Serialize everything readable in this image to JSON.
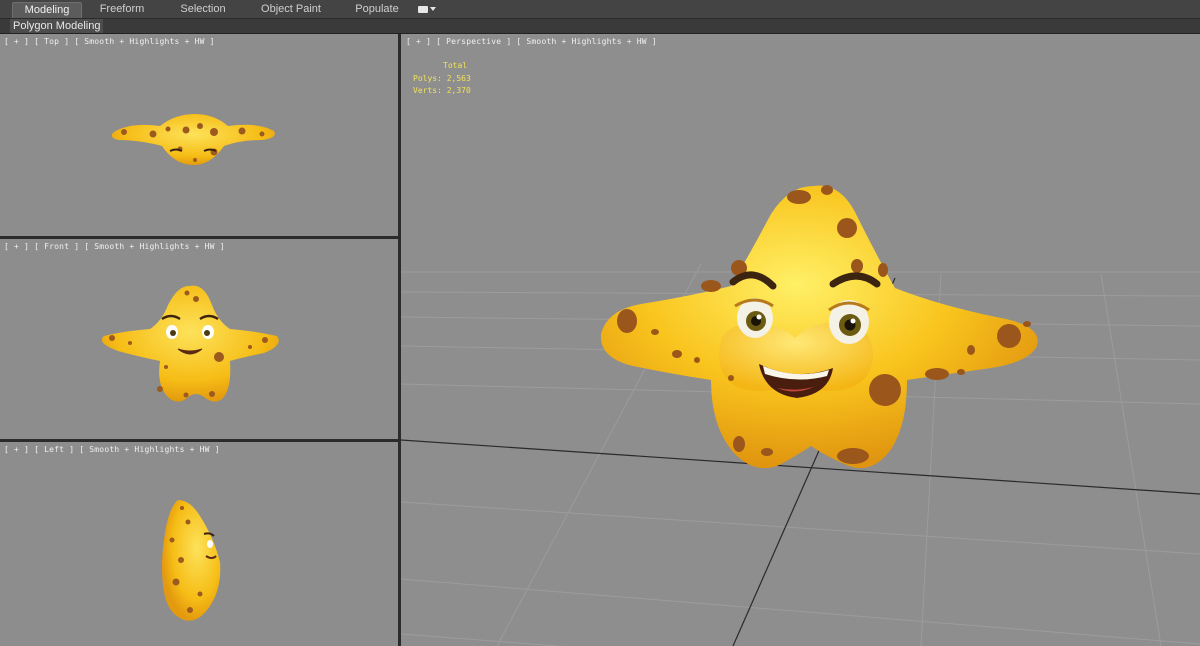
{
  "ribbon": {
    "tabs": [
      {
        "label": "Modeling",
        "active": true
      },
      {
        "label": "Freeform",
        "active": false
      },
      {
        "label": "Selection",
        "active": false
      },
      {
        "label": "Object Paint",
        "active": false
      },
      {
        "label": "Populate",
        "active": false
      }
    ],
    "panel_label": "Polygon Modeling"
  },
  "viewports": {
    "top": {
      "label": "[ + ] [ Top ] [ Smooth + Highlights + HW ]"
    },
    "front": {
      "label": "[ + ] [ Front ] [ Smooth + Highlights + HW ]"
    },
    "left": {
      "label": "[ + ] [ Left ] [ Smooth + Highlights + HW ]"
    },
    "perspective": {
      "label": "[ + ] [ Perspective ] [ Smooth + Highlights + HW ]",
      "stats": {
        "total_label": "Total",
        "polys": "Polys: 2,563",
        "verts": "Verts: 2,370"
      }
    }
  },
  "colors": {
    "viewport_bg": "#8d8d8d",
    "model_yellow": "#f7c21a",
    "model_shadow": "#e09a10",
    "spots": "#9c5a1e",
    "stats_text": "#f1e25a"
  }
}
